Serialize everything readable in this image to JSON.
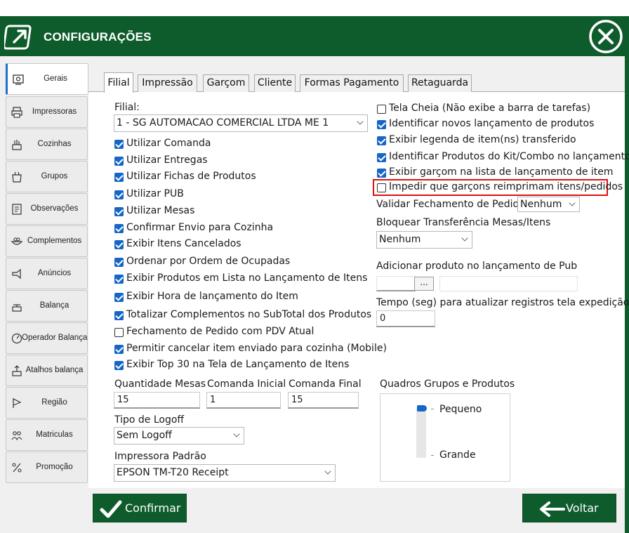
{
  "window": {
    "title": "CONFIGURAÇÕES"
  },
  "colors": {
    "header": "#0e5c2c",
    "accent": "#1466c8",
    "highlight_border": "#e01010"
  },
  "sidebar": {
    "items": [
      {
        "label": "Gerais",
        "icon": "settings-panel-icon",
        "active": true
      },
      {
        "label": "Impressoras",
        "icon": "printer-icon"
      },
      {
        "label": "Cozinhas",
        "icon": "kitchen-icon"
      },
      {
        "label": "Grupos",
        "icon": "groups-icon"
      },
      {
        "label": "Observações",
        "icon": "notes-icon"
      },
      {
        "label": "Complementos",
        "icon": "complements-icon"
      },
      {
        "label": "Anúncios",
        "icon": "announcement-icon"
      },
      {
        "label": "Balança",
        "icon": "scale-icon"
      },
      {
        "label": "Operador  Balança",
        "icon": "operator-scale-icon"
      },
      {
        "label": "Atalhos balança",
        "icon": "scale-shortcut-icon"
      },
      {
        "label": "Região",
        "icon": "region-flag-icon"
      },
      {
        "label": "Matriculas",
        "icon": "registration-icon"
      },
      {
        "label": "Promoção",
        "icon": "promotion-icon"
      }
    ]
  },
  "tabs": [
    "Filial",
    "Impressão",
    "Garçom",
    "Cliente",
    "Formas Pagamento",
    "Retaguarda"
  ],
  "left": {
    "filial_label": "Filial:",
    "filial_value": "1 - SG AUTOMACAO COMERCIAL LTDA ME 1",
    "checkboxes": [
      {
        "label": "Utilizar Comanda",
        "checked": true
      },
      {
        "label": "Utilizar Entregas",
        "checked": true
      },
      {
        "label": "Utilizar Fichas de Produtos",
        "checked": true
      },
      {
        "label": "Utilizar PUB",
        "checked": true
      },
      {
        "label": "Utilizar Mesas",
        "checked": true
      },
      {
        "label": "Confirmar Envio para Cozinha",
        "checked": true
      },
      {
        "label": "Exibir Itens Cancelados",
        "checked": true
      },
      {
        "label": "Ordenar por Ordem de Ocupadas",
        "checked": true
      },
      {
        "label": "Exibir Produtos em Lista no Lançamento de Itens",
        "checked": true
      },
      {
        "label": "Exibir Hora de lançamento do Item",
        "checked": true
      },
      {
        "label": "Totalizar Complementos no SubTotal dos Produtos",
        "checked": true
      },
      {
        "label": "Fechamento de Pedido com PDV Atual",
        "checked": false
      },
      {
        "label": "Permitir cancelar item enviado para cozinha (Mobile)",
        "checked": true
      },
      {
        "label": "Exibir Top 30 na Tela de Lançamento de Itens",
        "checked": true
      }
    ],
    "qtd_mesas_label": "Quantidade Mesas",
    "qtd_mesas_value": "15",
    "comanda_inicial_label": "Comanda Inicial",
    "comanda_inicial_value": "1",
    "comanda_final_label": "Comanda Final",
    "comanda_final_value": "15",
    "logoff_label": "Tipo de Logoff",
    "logoff_value": "Sem Logoff",
    "impressora_label": "Impressora Padrão",
    "impressora_value": "EPSON TM-T20 Receipt"
  },
  "right": {
    "checkboxes": [
      {
        "label": "Tela Cheia (Não exibe a barra de tarefas)",
        "checked": false
      },
      {
        "label": "Identificar novos lançamento de produtos",
        "checked": true
      },
      {
        "label": "Exibir legenda de item(ns) transferido",
        "checked": true
      },
      {
        "label": "Identificar Produtos do Kit/Combo no lançamento",
        "checked": true
      },
      {
        "label": "Exibir garçom na lista de lançamento de item",
        "checked": true
      },
      {
        "label": "Impedir que garçons reimprimam itens/pedidos",
        "checked": false
      }
    ],
    "validar_label": "Validar Fechamento de Pedido",
    "validar_value": "Nenhum",
    "bloquear_label": "Bloquear Transferência Mesas/Itens",
    "bloquear_value": "Nenhum",
    "adicionar_label": "Adicionar produto no lançamento de Pub",
    "adicionar_value": "",
    "browse_label": "...",
    "tempo_label": "Tempo (seg) para atualizar registros tela expedição",
    "tempo_value": "0",
    "quadros_label": "Quadros Grupos e Produtos",
    "quadros_small": "Pequeno",
    "quadros_large": "Grande",
    "quadros_level": 0
  },
  "footer": {
    "confirm_label": "Confirmar",
    "back_label": "Voltar"
  }
}
